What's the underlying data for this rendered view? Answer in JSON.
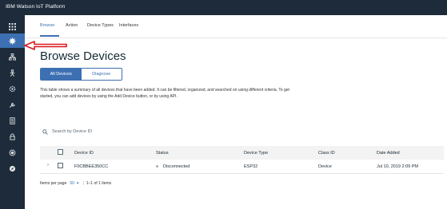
{
  "app": {
    "title": "IBM Watson IoT Platform"
  },
  "tabs": [
    {
      "label": "Browse"
    },
    {
      "label": "Action"
    },
    {
      "label": "Device Types"
    },
    {
      "label": "Interfaces"
    }
  ],
  "page": {
    "title": "Browse Devices",
    "segments": {
      "all_devices": "All Devices",
      "diagnose": "Diagnose"
    },
    "description": "This table shows a summary of all devices that have been added. It can be filtered, organized, and searched on using different criteria. To get started, you can add devices by using the Add Device button, or by using API."
  },
  "search": {
    "placeholder": "Search by Device ID"
  },
  "table": {
    "headers": {
      "device_id": "Device ID",
      "status": "Status",
      "device_type": "Device Type",
      "class_id": "Class ID",
      "date_added": "Date Added"
    },
    "rows": [
      {
        "device_id": "F0CBBEE350CC",
        "status": "Disconnected",
        "device_type": "ESP32",
        "class_id": "Device",
        "date_added": "Jul 10, 2019 2:09 PM"
      }
    ]
  },
  "pagination": {
    "items_per_page_label": "Items per page",
    "items_per_page": "50",
    "range": "1–1 of 1 items"
  },
  "icons": [
    "apps-icon",
    "settings-icon",
    "hierarchy-icon",
    "person-icon",
    "gear-icon",
    "tool-icon",
    "document-icon",
    "lock-icon",
    "security-icon",
    "compass-icon"
  ],
  "colors": {
    "nav_bg": "#1d2b3a",
    "accent": "#3d70b2",
    "arrow": "#d9181e"
  }
}
